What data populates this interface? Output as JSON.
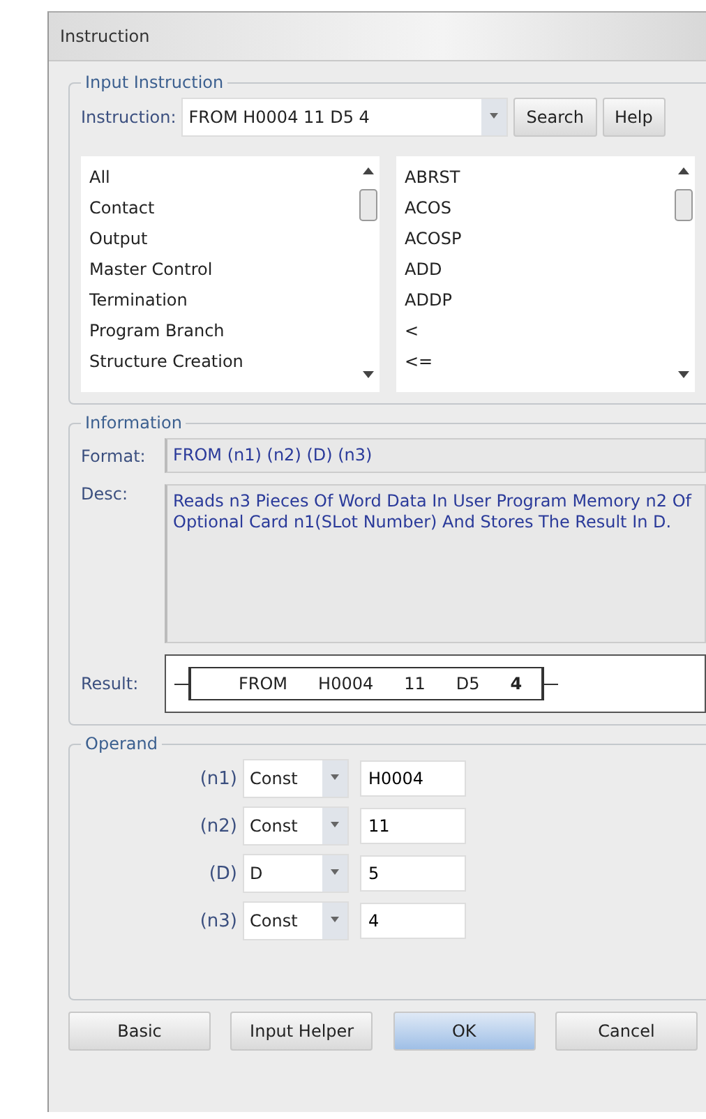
{
  "window": {
    "title": "Instruction"
  },
  "input_instruction": {
    "legend": "Input Instruction",
    "label": "Instruction:",
    "value": "FROM H0004 11 D5 4",
    "buttons": [
      "Search",
      "Help"
    ],
    "categories": [
      "All",
      "Contact",
      "Output",
      "Master Control",
      "Termination",
      "Program Branch",
      "Structure Creation"
    ],
    "instructions": [
      "ABRST",
      "ACOS",
      "ACOSP",
      "ADD",
      "ADDP",
      "<",
      "<="
    ]
  },
  "information": {
    "legend": "Information",
    "format_label": "Format:",
    "format": "FROM (n1) (n2) (D) (n3)",
    "desc_label": "Desc:",
    "desc": "Reads n3 Pieces Of Word Data In User Program Memory n2 Of Optional Card n1(SLot Number) And Stores The Result In D.",
    "result_label": "Result:",
    "result": [
      {
        "text": "FROM",
        "bold": false
      },
      {
        "text": "H0004",
        "bold": false
      },
      {
        "text": "11",
        "bold": false
      },
      {
        "text": "D5",
        "bold": false
      },
      {
        "text": "4",
        "bold": true
      }
    ]
  },
  "operand": {
    "legend": "Operand",
    "rows": [
      {
        "label": "(n1)",
        "type": "Const",
        "value": "H0004"
      },
      {
        "label": "(n2)",
        "type": "Const",
        "value": "11"
      },
      {
        "label": "(D)",
        "type": "D",
        "value": "5"
      },
      {
        "label": "(n3)",
        "type": "Const",
        "value": "4"
      }
    ]
  },
  "buttons": [
    {
      "label": "Basic",
      "default": false
    },
    {
      "label": "Input Helper",
      "default": false
    },
    {
      "label": "OK",
      "default": true
    },
    {
      "label": "Cancel",
      "default": false
    }
  ]
}
